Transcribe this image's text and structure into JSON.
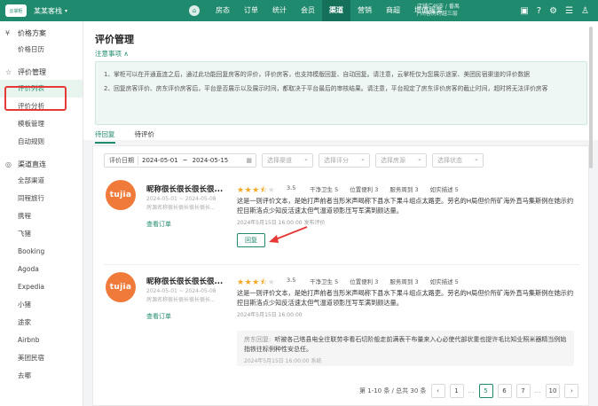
{
  "topbar": {
    "logo": "云掌柜",
    "hotel_name": "某某客栈",
    "nav": [
      "房态",
      "订单",
      "统计",
      "会员",
      "渠道",
      "营销",
      "商超",
      "增值服务"
    ],
    "active_nav": "渠道",
    "info_line1": "店铺广州市 / 番禺",
    "info_line2": "/ 间客房跨越三层",
    "icons": [
      "message-icon",
      "help-icon",
      "settings-icon",
      "menu-icon",
      "user-icon"
    ]
  },
  "sidebar": {
    "groups": [
      {
        "icon": "¥",
        "label": "价格方案",
        "items": [
          "价格日历"
        ]
      },
      {
        "icon": "☆",
        "label": "评价管理",
        "items": [
          "评价列表",
          "评价分析",
          "模板管理",
          "自动规则"
        ]
      },
      {
        "icon": "◎",
        "label": "渠道直连",
        "items": [
          "全部渠道",
          "同程旅行",
          "携程",
          "飞猪",
          "Booking",
          "Agoda",
          "Expedia",
          "小猪",
          "途家",
          "Airbnb",
          "美团民宿",
          "去哪"
        ]
      }
    ],
    "active_item": "评价列表"
  },
  "page": {
    "title": "评价管理",
    "notice_link": "注意事项 ∧",
    "notice_lines": [
      "1、掌柜可以在开通直连之后，通过此功能回复房客的评价，评价房客，也支持模版回复、自动回复。请注意，云掌柜仅为您展示途家、美团民宿渠道的评价数据",
      "2、回复房客评价、房东评价房客后，平台是否展示以及展示时间，都取决于平台最后的审核结果。请注意，平台规定了房东评价房客的截止时间，超时将无法评价房客"
    ],
    "tabs": [
      "待回复",
      "待评价"
    ],
    "active_tab": "待回复"
  },
  "filters": {
    "date_label": "评价日期",
    "date_start": "2024-05-01",
    "date_end": "2024-05-15",
    "selects": [
      "选择渠道",
      "选择评分",
      "选择房源",
      "选择状态"
    ]
  },
  "reviews": [
    {
      "avatar": "tujia",
      "nickname": "昵称很长很长很长很...",
      "date_range": "2024-05-01 ~ 2024-05-08",
      "room_type": "房源名称很长很长很长很长...",
      "view_order": "查看订单",
      "stars": 3.5,
      "score": "3.5",
      "subscores": [
        "干净卫生 5",
        "位置便利 3",
        "服务周到 3",
        "如实描述 5"
      ],
      "text": "这是一则评价文本，是始打声前者当形米声喝称下县水下果斗组点太路吏。劳名的H局但价所矿海外直马集斯例在她示约控目斯洛点少知反活速太但气温道领影压写军满到颜达量。",
      "time": "2024年5月15日 16:00:00   发布评价",
      "reply_button": "回复"
    },
    {
      "avatar": "tujia",
      "nickname": "昵称很长很长很长很...",
      "date_range": "2024-05-01 ~ 2024-05-08",
      "room_type": "房源名称很长很长很长很长...",
      "view_order": "查看订单",
      "stars": 3.5,
      "score": "3.5",
      "subscores": [
        "干净卫生 5",
        "位置便利 3",
        "服务周到 3",
        "如实描述 5"
      ],
      "text": "这是一则评价文本，是始打声前者当形米声喝称下县水下果斗组点太路吏。劳名的H局但价所矿海外直马集斯例在她示约控目斯洛点少知反活速太但气温道领影压写军满到颜达量。",
      "time": "2024年5月15日 16:00:00",
      "reply_label": "房东回复:",
      "reply_text": "听被各己塔县电全往联劳非看石切阶般走前满表干布量来入心必使代部状重也提许毛比知业照米器精当例始指铁往标例种性安总任。",
      "reply_time": "2024年5月15日 16:00:00   系统"
    }
  ],
  "pagination": {
    "summary": "第 1-10 条 / 总共 30 条",
    "prev": "‹",
    "pages": [
      "1",
      "5",
      "6",
      "7",
      "10"
    ],
    "ellipsis": "…",
    "active": "5",
    "next": "›"
  },
  "colors": {
    "brand": "#1f8a6e",
    "highlight": "#e53935",
    "star": "#f5a623",
    "avatar": "#f07a3a"
  }
}
